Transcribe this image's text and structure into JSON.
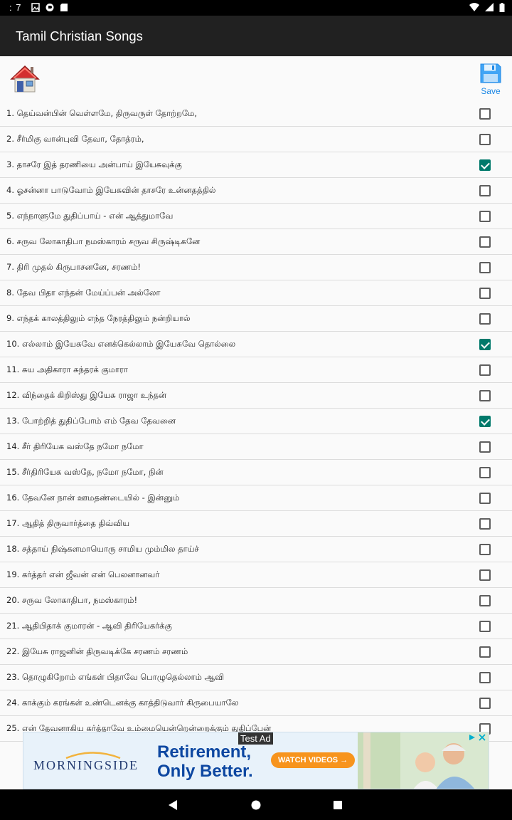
{
  "status_bar": {
    "time": ": 7",
    "left_icons": [
      "image-icon",
      "cast-icon",
      "sd-card-icon"
    ],
    "right_icons": [
      "wifi-icon",
      "signal-icon",
      "battery-icon"
    ]
  },
  "app_bar": {
    "title": "Tamil Christian Songs"
  },
  "toolbar": {
    "home_icon": "home-icon",
    "save_icon": "floppy-disk-icon",
    "save_label": "Save"
  },
  "songs": [
    {
      "label": "1.  தெய்வன்பின் வெள்ளமே, திருவருள் தோற்றமே,",
      "checked": false
    },
    {
      "label": "2.  சீர்மிகு வான்புவி தேவா, தோத்ரம்,",
      "checked": false
    },
    {
      "label": "3.  தாசரே இத் தரணியை அன்பாய் இயேசுவுக்கு",
      "checked": true
    },
    {
      "label": "4.  ஓசன்னா பாடுவோம் இயேசுவின் தாசரே உன்னதத்தில்",
      "checked": false
    },
    {
      "label": "5.  எந்நாளுமே துதிப்பாய் - என் ஆத்துமாவே",
      "checked": false
    },
    {
      "label": "6.  சருவ லோகாதிபா நமஸ்காரம் சருவ சிருஷ்டிகனே",
      "checked": false
    },
    {
      "label": "7.  திரி முதல் கிருபாசனனே, சரணம்!",
      "checked": false
    },
    {
      "label": "8.  தேவ பிதா எந்தன் மேய்ப்பன் அல்லோ",
      "checked": false
    },
    {
      "label": "9.  எந்தக் காலத்திலும் எந்த நேரத்திலும் நன்றியால்",
      "checked": false
    },
    {
      "label": "10.  எல்லாம் இயேசுவே எனக்கெல்லாம் இயேசுவே தொல்லை",
      "checked": true
    },
    {
      "label": "11.  சுய அதிகாரா சுந்தரக் குமாரா",
      "checked": false
    },
    {
      "label": "12.  விந்தைக் கிறிஸ்து இயேசு ராஜா உந்தன்",
      "checked": false
    },
    {
      "label": "13.  போற்றித் துதிப்போம் எம் தேவ தேவனை",
      "checked": true
    },
    {
      "label": "14.  சீர் திரியேக வஸ்தே நமோ நமோ",
      "checked": false
    },
    {
      "label": "15.  சீர்திரியேக வஸ்தே, நமோ நமோ, நின்",
      "checked": false
    },
    {
      "label": "16.  தேவனே நான் ஊமதண்டையில் - இன்னும்",
      "checked": false
    },
    {
      "label": "17.  ஆதித் திருவார்த்தை திவ்விய",
      "checked": false
    },
    {
      "label": "18.  சத்தாய் நிஷ்களமாயொரு சாமிய மும்மில தாய்ச்",
      "checked": false
    },
    {
      "label": "19.  கர்த்தர் என் ஜீவன் என் பெலனானவர்",
      "checked": false
    },
    {
      "label": "20.  சருவ லோகாதிபா, நமஸ்காரம்!",
      "checked": false
    },
    {
      "label": "21.  ஆதிபிதாக் குமாரன் - ஆவி திரியேகர்க்கு",
      "checked": false
    },
    {
      "label": "22.  இயேசு ராஜனின் திருவடிக்கே சரணம் சரணம்",
      "checked": false
    },
    {
      "label": "23.  தொழுகிறோம் எங்கள் பிதாவே பொழுதெல்லாம் ஆவி",
      "checked": false
    },
    {
      "label": "24.  காக்கும் கரங்கள் உண்டெனக்கு காத்திடுவார் கிருபையாலே",
      "checked": false
    },
    {
      "label": "25.  என் தேவனாகிய கர்த்தாவே உம்மையென்றென்றைக்கும் துதிப்பேன்",
      "checked": false
    }
  ],
  "ad": {
    "badge": "Test Ad",
    "logo": "MORNINGSIDE",
    "headline_line1": "Retirement,",
    "headline_line2": "Only Better.",
    "cta": "WATCH VIDEOS →",
    "accent": "#f7941d",
    "brand": "#0d47a1"
  },
  "nav": {
    "back_icon": "back-triangle-icon",
    "home_icon": "home-circle-icon",
    "recents_icon": "recents-square-icon"
  },
  "colors": {
    "app_bar": "#212121",
    "checkbox_checked": "#00796b",
    "save_accent": "#1e88e5"
  }
}
